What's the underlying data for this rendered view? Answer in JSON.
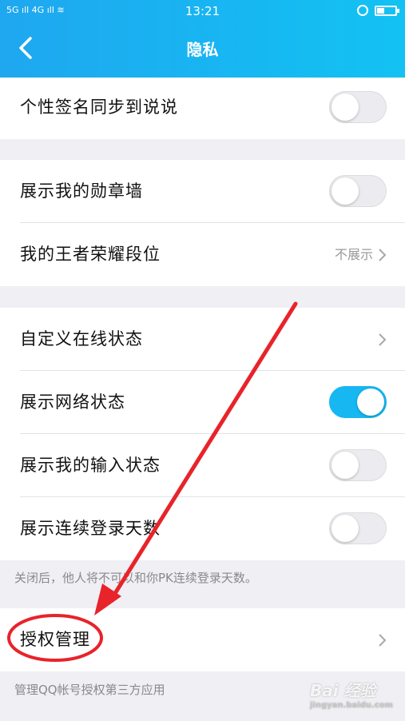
{
  "status_bar": {
    "signal": "5G ıll 4G ıll ≋",
    "time": "13:21"
  },
  "header": {
    "title": "隐私"
  },
  "rows": {
    "signature_sync": {
      "label": "个性签名同步到说说",
      "toggle_on": false
    },
    "medal_wall": {
      "label": "展示我的勋章墙",
      "toggle_on": false
    },
    "honor_rank": {
      "label": "我的王者荣耀段位",
      "value": "不展示"
    },
    "custom_status": {
      "label": "自定义在线状态"
    },
    "network_status": {
      "label": "展示网络状态",
      "toggle_on": true
    },
    "input_status": {
      "label": "展示我的输入状态",
      "toggle_on": false
    },
    "login_days": {
      "label": "展示连续登录天数",
      "toggle_on": false
    },
    "auth_manage": {
      "label": "授权管理"
    }
  },
  "notes": {
    "login_days_note": "关闭后，他人将不可以和你PK连续登录天数。",
    "auth_note": "管理QQ帐号授权第三方应用"
  },
  "watermark": {
    "text": "Bai 经验",
    "sub": "jingyan.baidu.com"
  },
  "colors": {
    "accent": "#17b7f2",
    "annotation": "#e8232a"
  }
}
